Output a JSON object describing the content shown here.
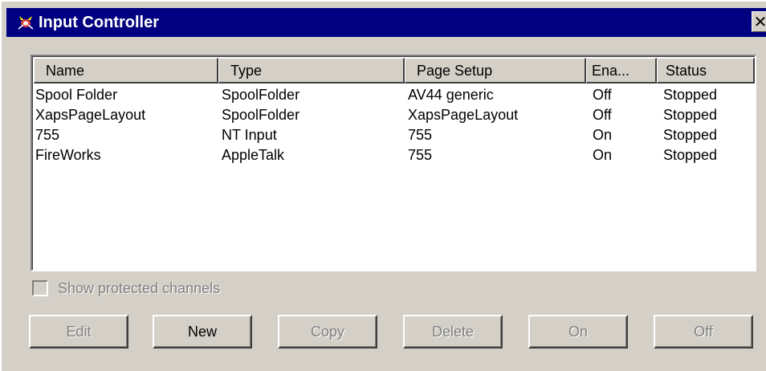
{
  "window": {
    "title": "Input Controller",
    "close_glyph": "✕"
  },
  "list": {
    "columns": [
      "Name",
      "Type",
      "Page Setup",
      "Ena...",
      "Status"
    ],
    "rows": [
      {
        "name": "Spool Folder",
        "type": "SpoolFolder",
        "page_setup": "AV44 generic",
        "enabled": "Off",
        "status": "Stopped"
      },
      {
        "name": "XapsPageLayout",
        "type": "SpoolFolder",
        "page_setup": "XapsPageLayout",
        "enabled": "Off",
        "status": "Stopped"
      },
      {
        "name": "755",
        "type": "NT Input",
        "page_setup": "755",
        "enabled": "On",
        "status": "Stopped"
      },
      {
        "name": "FireWorks",
        "type": "AppleTalk",
        "page_setup": "755",
        "enabled": "On",
        "status": "Stopped"
      }
    ]
  },
  "options": {
    "show_protected_label": "Show protected channels",
    "show_protected_checked": false
  },
  "buttons": {
    "edit": "Edit",
    "new": "New",
    "copy": "Copy",
    "delete": "Delete",
    "on": "On",
    "off": "Off"
  },
  "icons": {
    "app": "input-controller-icon",
    "close": "close-icon"
  },
  "colors": {
    "titlebar": "#000080",
    "face": "#d4d0c8",
    "disabled_text": "#808080"
  }
}
